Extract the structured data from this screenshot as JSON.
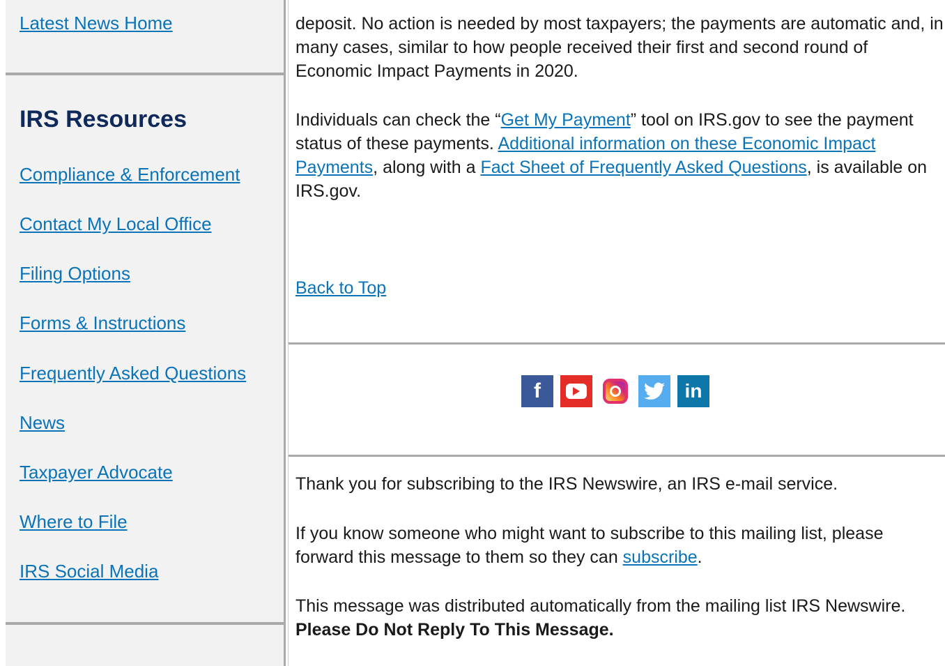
{
  "sidebar": {
    "latest_news": "Latest News Home",
    "resources_heading": "IRS Resources",
    "links": [
      "Compliance & Enforcement",
      "Contact My Local Office",
      "Filing Options",
      "Forms & Instructions",
      "Frequently Asked Questions",
      "News",
      "Taxpayer Advocate",
      "Where to File",
      "IRS Social Media"
    ]
  },
  "article": {
    "para1": "deposit. No action is needed by most taxpayers; the payments are automatic and, in many cases, similar to how people received their first and second round of Economic Impact Payments in 2020.",
    "para2_before": "Individuals can check the “",
    "para2_link1": "Get My Payment",
    "para2_mid1": "” tool on IRS.gov to see the payment status of these payments. ",
    "para2_link2": "Additional information on these Economic Impact Payments",
    "para2_mid2": ", along with a ",
    "para2_link3": "Fact Sheet of Frequently Asked Questions",
    "para2_after": ", is available on IRS.gov.",
    "back_to_top": "Back to Top"
  },
  "social": {
    "icons": [
      "facebook-icon",
      "youtube-icon",
      "instagram-icon",
      "twitter-icon",
      "linkedin-icon"
    ],
    "facebook_glyph": "f",
    "linkedin_glyph": "in"
  },
  "footer": {
    "thanks": "Thank you for subscribing to the IRS Newswire, an IRS e-mail service.",
    "forward_before": "If you know someone who might want to subscribe to this mailing list, please forward this message to them so they can ",
    "forward_link": "subscribe",
    "forward_after": ".",
    "dist_before": "This message was distributed automatically from the mailing list IRS Newswire. ",
    "dist_bold": "Please Do Not Reply To This Message."
  }
}
